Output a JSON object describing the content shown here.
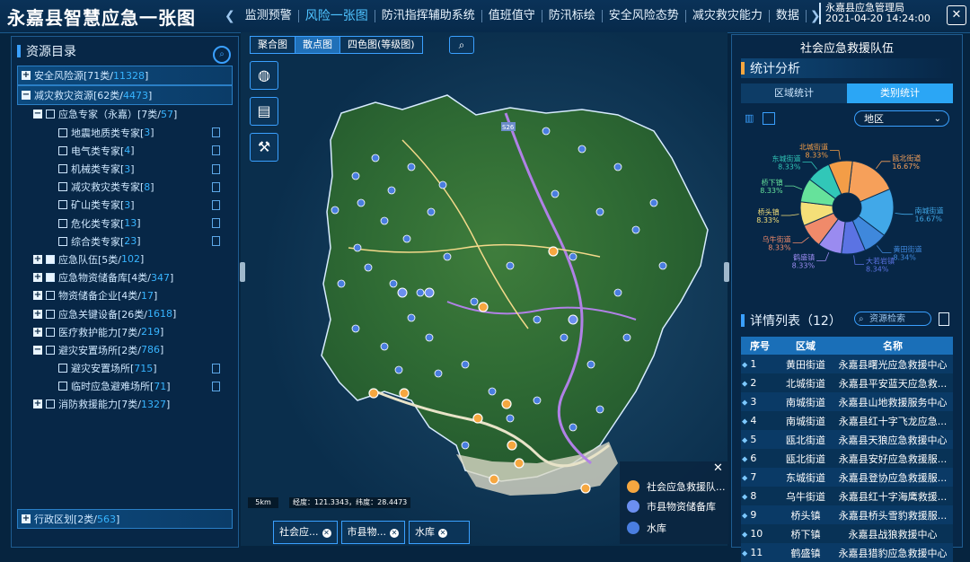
{
  "header": {
    "title": "永嘉县智慧应急一张图",
    "nav": [
      "监测预警",
      "风险一张图",
      "防汛指挥辅助系统",
      "值班值守",
      "防汛标绘",
      "安全风险态势",
      "减灾救灾能力",
      "数据"
    ],
    "active_nav": "风险一张图",
    "org": "永嘉县应急管理局",
    "datetime": "2021-04-20 14:24:00"
  },
  "left_panel": {
    "title": "资源目录",
    "tree": [
      {
        "label": "安全风险源[71类/",
        "count": "11328",
        "level": 0,
        "toggle": "+",
        "top": true
      },
      {
        "label": "减灾救灾资源[62类/",
        "count": "4473",
        "level": 0,
        "toggle": "−",
        "top": true
      },
      {
        "label": "应急专家（永嘉）[7类/",
        "count": "57",
        "level": 1,
        "toggle": "−"
      },
      {
        "label": "地震地质类专家[",
        "count": "3",
        "level": 2,
        "doc": true
      },
      {
        "label": "电气类专家[",
        "count": "4",
        "level": 2,
        "doc": true
      },
      {
        "label": "机械类专家[",
        "count": "3",
        "level": 2,
        "doc": true
      },
      {
        "label": "减灾救灾类专家[",
        "count": "8",
        "level": 2,
        "doc": true
      },
      {
        "label": "矿山类专家[",
        "count": "3",
        "level": 2,
        "doc": true
      },
      {
        "label": "危化类专家[",
        "count": "13",
        "level": 2,
        "doc": true
      },
      {
        "label": "综合类专家[",
        "count": "23",
        "level": 2,
        "doc": true
      },
      {
        "label": "应急队伍[5类/",
        "count": "102",
        "level": 1,
        "toggle": "+",
        "checked": true
      },
      {
        "label": "应急物资储备库[4类/",
        "count": "347",
        "level": 1,
        "toggle": "+",
        "checked": true
      },
      {
        "label": "物资储备企业[4类/",
        "count": "17",
        "level": 1,
        "toggle": "+"
      },
      {
        "label": "应急关键设备[26类/",
        "count": "1618",
        "level": 1,
        "toggle": "+"
      },
      {
        "label": "医疗救护能力[7类/",
        "count": "219",
        "level": 1,
        "toggle": "+"
      },
      {
        "label": "避灾安置场所[2类/",
        "count": "786",
        "level": 1,
        "toggle": "−"
      },
      {
        "label": "避灾安置场所[",
        "count": "715",
        "level": 2,
        "doc": true
      },
      {
        "label": "临时应急避难场所[",
        "count": "71",
        "level": 2,
        "doc": true
      },
      {
        "label": "消防救援能力[7类/",
        "count": "1327",
        "level": 1,
        "toggle": "+"
      }
    ],
    "bottom": {
      "label": "行政区划[2类/",
      "count": "563"
    }
  },
  "map": {
    "tabs": [
      "聚合图",
      "散点图",
      "四色图(等级图)"
    ],
    "active_tab": "散点图",
    "scale": "5km",
    "coords": "经度：121.3343，纬度：28.4473",
    "road_label": "S26",
    "icons": {
      "tools": [
        "globe-icon",
        "layers-icon",
        "wrench-icon"
      ]
    }
  },
  "legend": {
    "items": [
      {
        "label": "社会应急救援队...",
        "color": "#f6a740"
      },
      {
        "label": "市县物资储备库",
        "color": "#6c8ff0"
      },
      {
        "label": "水库",
        "color": "#4a7ee0"
      }
    ]
  },
  "chips": [
    "社会应...",
    "市县物...",
    "水库"
  ],
  "right_panel": {
    "title": "社会应急救援队伍",
    "stats_title": "统计分析",
    "tabs": [
      "区域统计",
      "类别统计"
    ],
    "active_tab": "类别统计",
    "select": "地区",
    "detail_title": "详情列表（12）",
    "search_placeholder": "资源检索",
    "table_headers": [
      "序号",
      "区域",
      "名称"
    ],
    "rows": [
      {
        "idx": "1",
        "region": "黄田街道",
        "name": "永嘉县曙光应急救援中心"
      },
      {
        "idx": "2",
        "region": "北城街道",
        "name": "永嘉县平安蓝天应急救..."
      },
      {
        "idx": "3",
        "region": "南城街道",
        "name": "永嘉县山地救援服务中心"
      },
      {
        "idx": "4",
        "region": "南城街道",
        "name": "永嘉县红十字飞龙应急..."
      },
      {
        "idx": "5",
        "region": "瓯北街道",
        "name": "永嘉县天狼应急救援中心"
      },
      {
        "idx": "6",
        "region": "瓯北街道",
        "name": "永嘉县安好应急救援服..."
      },
      {
        "idx": "7",
        "region": "东城街道",
        "name": "永嘉县登协应急救援服..."
      },
      {
        "idx": "8",
        "region": "乌牛街道",
        "name": "永嘉县红十字海鹰救援..."
      },
      {
        "idx": "9",
        "region": "桥头镇",
        "name": "永嘉县桥头雪豹救援服..."
      },
      {
        "idx": "10",
        "region": "桥下镇",
        "name": "永嘉县战狼救援中心"
      },
      {
        "idx": "11",
        "region": "鹤盛镇",
        "name": "永嘉县猎豹应急救援中心"
      }
    ]
  },
  "chart_data": {
    "type": "pie",
    "slices": [
      {
        "label": "瓯北街道",
        "value": 16.67,
        "pct": "16.67%",
        "color": "#f6a05a"
      },
      {
        "label": "南城街道",
        "value": 16.67,
        "pct": "16.67%",
        "color": "#41a8e8"
      },
      {
        "label": "黄田街道",
        "value": 8.34,
        "pct": "8.34%",
        "color": "#3f88dc"
      },
      {
        "label": "大若岩镇",
        "value": 8.34,
        "pct": "8.34%",
        "color": "#5b73e3"
      },
      {
        "label": "鹤盛镇",
        "value": 8.33,
        "pct": "8.33%",
        "color": "#9a8bf0"
      },
      {
        "label": "乌牛街道",
        "value": 8.33,
        "pct": "8.33%",
        "color": "#f08a6a"
      },
      {
        "label": "桥头镇",
        "value": 8.33,
        "pct": "8.33%",
        "color": "#f4df78"
      },
      {
        "label": "桥下镇",
        "value": 8.33,
        "pct": "8.33%",
        "color": "#66e29b"
      },
      {
        "label": "东城街道",
        "value": 8.33,
        "pct": "8.33%",
        "color": "#31c7b8"
      },
      {
        "label": "北城街道",
        "value": 8.33,
        "pct": "8.33%",
        "color": "#f39d47"
      }
    ]
  }
}
